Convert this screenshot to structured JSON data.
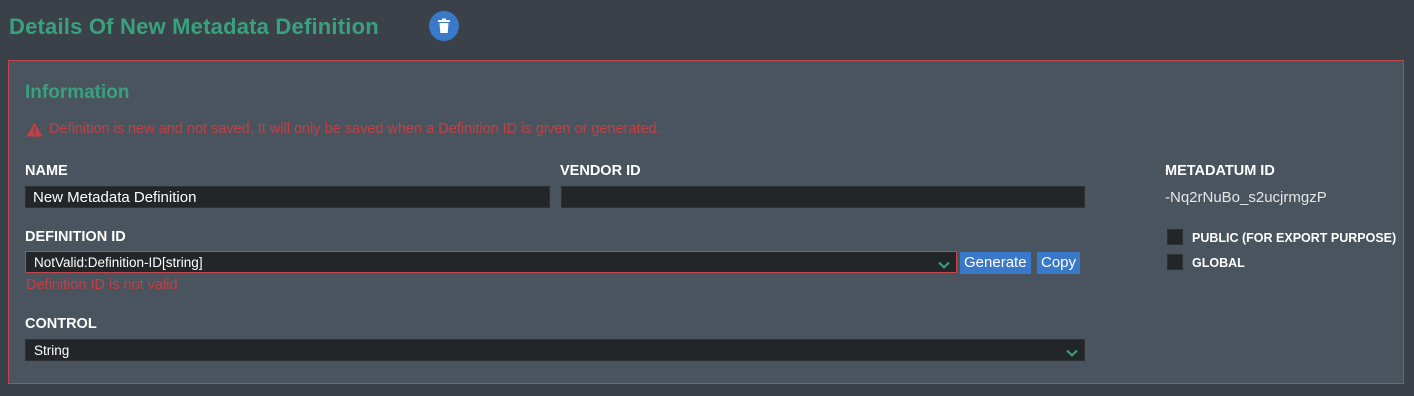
{
  "header": {
    "title": "Details Of New Metadata Definition",
    "delete_icon": "trash-icon"
  },
  "panel": {
    "section_title": "Information",
    "warning": {
      "icon": "warning-triangle-icon",
      "text": "Definition is new and not saved. It will only be saved when a Definition ID is given or generated."
    },
    "name": {
      "label": "NAME",
      "value": "New Metadata Definition"
    },
    "vendor_id": {
      "label": "VENDOR ID",
      "value": ""
    },
    "definition_id": {
      "label": "DEFINITION ID",
      "value": "NotValid:Definition-ID[string]",
      "error": "Definition ID is not valid",
      "generate_label": "Generate",
      "copy_label": "Copy"
    },
    "control": {
      "label": "CONTROL",
      "value": "String"
    },
    "metadatum_id": {
      "label": "METADATUM ID",
      "value": "-Nq2rNuBo_s2ucjrmgzP"
    },
    "checkboxes": [
      {
        "label": "PUBLIC (FOR EXPORT PURPOSE)",
        "checked": false
      },
      {
        "label": "GLOBAL",
        "checked": false
      }
    ]
  },
  "colors": {
    "accent_green": "#3aa17e",
    "error_red": "#c43f43",
    "button_blue": "#3a78c9",
    "panel_bg": "#4a545e",
    "page_bg": "#3a4149",
    "input_bg": "#232629"
  }
}
